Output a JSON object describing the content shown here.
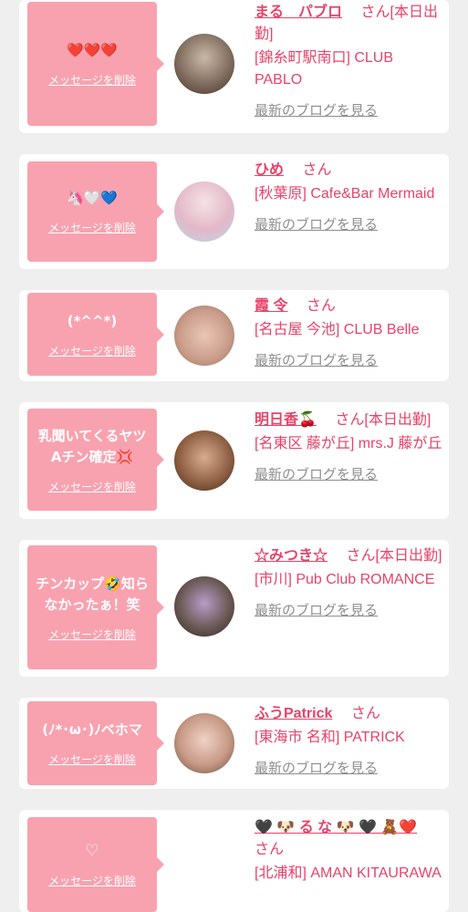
{
  "delete_label": "メッセージを削除",
  "blog_label": "最新のブログを見る",
  "san": "さん",
  "cards": [
    {
      "message": "❤️❤️❤️",
      "name": "まる　パブロ",
      "status": "[本日出勤]",
      "shop": "[錦糸町駅南口] CLUB PABLO"
    },
    {
      "message": "🦄🤍💙",
      "name": "ひめ",
      "status": "",
      "shop": "[秋葉原] Cafe&Bar Mermaid"
    },
    {
      "message": "(*^^*)",
      "name": "霞 令",
      "status": "",
      "shop": "[名古屋 今池] CLUB Belle"
    },
    {
      "message": "乳聞いてくるヤツAチン確定💢",
      "name": "明日香🍒",
      "status": "[本日出勤]",
      "shop": "[名東区 藤が丘] mrs.J 藤が丘"
    },
    {
      "message": "チンカップ🤣知らなかったぁ！笑",
      "name": "☆みつき☆",
      "status": "[本日出勤]",
      "shop": "[市川] Pub Club ROMANCE"
    },
    {
      "message": "(ﾉ*･ω･)ﾉベホマ",
      "name": "ふうPatrick",
      "status": "",
      "shop": "[東海市 名和] PATRICK"
    },
    {
      "message": "♡",
      "name": "🖤 🐶 る な 🐶 🖤 🧸❤️",
      "status": "",
      "shop": "[北浦和] AMAN KITAURAWA"
    }
  ]
}
